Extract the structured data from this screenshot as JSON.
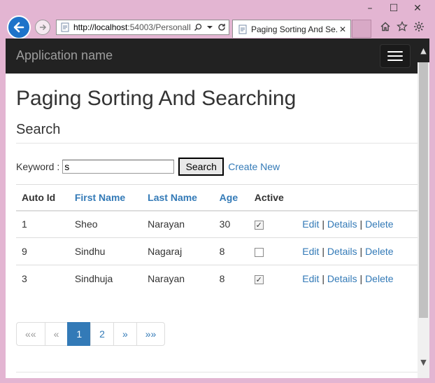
{
  "browser": {
    "window_controls": [
      "–",
      "☐",
      "✕"
    ],
    "url_host": "http://localhost",
    "url_rest": ":54003/PersonalI",
    "tab_title": "Paging Sorting And Se...",
    "tab_close": "✕"
  },
  "navbar": {
    "brand": "Application name"
  },
  "page": {
    "title": "Paging Sorting And Searching",
    "subtitle": "Search"
  },
  "search": {
    "label": "Keyword :",
    "value": "s",
    "button_label": "Search",
    "create_label": "Create New"
  },
  "table": {
    "headers": [
      "Auto Id",
      "First Name",
      "Last Name",
      "Age",
      "Active"
    ],
    "rows": [
      {
        "id": "1",
        "first": "Sheo",
        "last": "Narayan",
        "age": "30",
        "active": true
      },
      {
        "id": "9",
        "first": "Sindhu",
        "last": "Nagaraj",
        "age": "8",
        "active": false
      },
      {
        "id": "3",
        "first": "Sindhuja",
        "last": "Narayan",
        "age": "8",
        "active": true
      }
    ],
    "actions": {
      "edit": "Edit",
      "details": "Details",
      "delete": "Delete",
      "separator": "|"
    }
  },
  "pager": {
    "first": "««",
    "prev": "«",
    "pages": [
      "1",
      "2"
    ],
    "current": "1",
    "next": "»",
    "last": "»»"
  },
  "icons": [
    "back-arrow-icon",
    "forward-arrow-icon",
    "page-icon",
    "search-icon",
    "dropdown-icon",
    "refresh-icon",
    "home-icon",
    "star-icon",
    "gear-icon",
    "hamburger-icon"
  ]
}
